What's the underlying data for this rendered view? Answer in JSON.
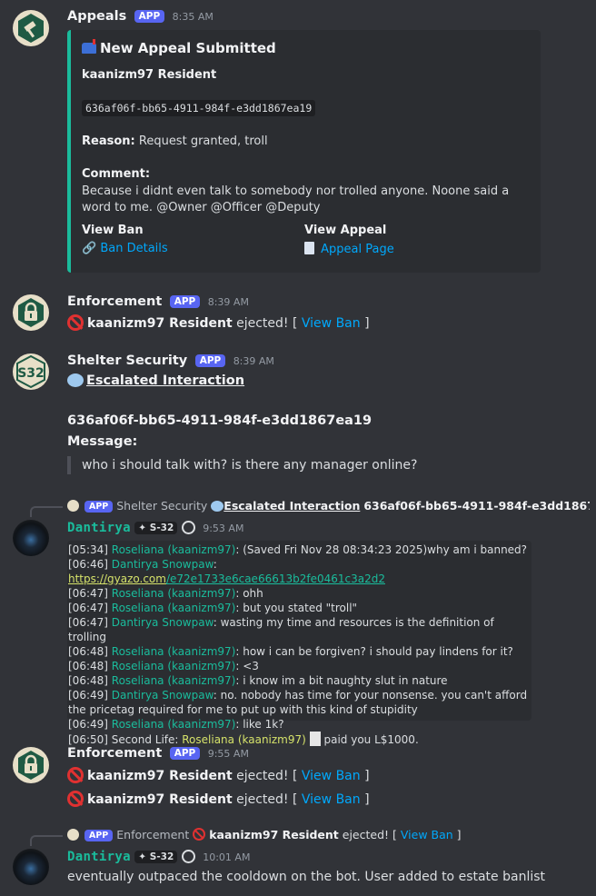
{
  "msg1": {
    "author": "Appeals",
    "tag": "APP",
    "time": "8:35 AM",
    "embed": {
      "title": "New Appeal Submitted",
      "user": "kaanizm97 Resident",
      "id": "636af06f-bb65-4911-984f-e3dd1867ea19",
      "reason_label": "Reason:",
      "reason": "Request granted, troll",
      "comment_label": "Comment:",
      "comment": "Because i didnt even talk to somebody nor trolled anyone. Noone said a word to me. @Owner @Officer @Deputy",
      "field1_title": "View Ban",
      "field1_link": "Ban Details",
      "field2_title": "View Appeal",
      "field2_link": "Appeal Page"
    }
  },
  "msg2": {
    "author": "Enforcement",
    "tag": "APP",
    "time": "8:39 AM",
    "user": "kaanizm97 Resident",
    "text": "ejected! [",
    "link": "View Ban",
    "close": "]"
  },
  "msg3": {
    "author": "Shelter Security",
    "tag": "APP",
    "time": "8:39 AM",
    "avatar_text": "S32",
    "title": "Escalated Interaction",
    "id": "636af06f-bb65-4911-984f-e3dd1867ea19",
    "message_label": "Message:",
    "quote": "who i should talk with? is there any manager online?"
  },
  "msg4": {
    "reply_tag": "APP",
    "reply_author": "Shelter Security",
    "reply_title": "Escalated Interaction",
    "reply_id": "636af06f-bb65-4911-984f-e3dd1867ea...",
    "author": "Dantirya",
    "badge": "S-32",
    "time": "9:53 AM",
    "log": [
      {
        "ts": "[05:34]",
        "who": "Roseliana (kaanizm97)",
        "text": ": (Saved Fri Nov 28 08:34:23 2025)why am i banned?"
      },
      {
        "ts": "[06:46]",
        "who": "Dantirya Snowpaw",
        "text": ": ",
        "url1": "https://gyazo.com",
        "url2": "/e72e1733e6cae66613b2fe0461c3a2d2"
      },
      {
        "ts": "[06:47]",
        "who": "Roseliana (kaanizm97)",
        "text": ": ohh"
      },
      {
        "ts": "[06:47]",
        "who": "Roseliana (kaanizm97)",
        "text": ": but you stated \"troll\""
      },
      {
        "ts": "[06:47]",
        "who": "Dantirya Snowpaw",
        "text": ": wasting my time and resources is the definition of trolling"
      },
      {
        "ts": "[06:48]",
        "who": "Roseliana (kaanizm97)",
        "text": ": how i can be forgiven? i should pay lindens for it?"
      },
      {
        "ts": "[06:48]",
        "who": "Roseliana (kaanizm97)",
        "text": ": <3"
      },
      {
        "ts": "[06:48]",
        "who": "Roseliana (kaanizm97)",
        "text": ": i know im a bit naughty slut in nature"
      },
      {
        "ts": "[06:49]",
        "who": "Dantirya Snowpaw",
        "text": ": no. nobody has time for your nonsense. you can't afford the pricetag required for me to put up with this kind of stupidity"
      },
      {
        "ts": "[06:49]",
        "who": "Roseliana (kaanizm97)",
        "text": ": like 1k?"
      },
      {
        "ts": "[06:50]",
        "who": "Second Life: ",
        "who2": "Roseliana (kaanizm97)",
        "text": " paid you L$1000."
      }
    ]
  },
  "msg5": {
    "author": "Enforcement",
    "tag": "APP",
    "time": "9:55 AM",
    "lines": [
      {
        "user": "kaanizm97 Resident",
        "text": "ejected! [",
        "link": "View Ban",
        "close": "]"
      },
      {
        "user": "kaanizm97 Resident",
        "text": "ejected! [",
        "link": "View Ban",
        "close": "]"
      }
    ]
  },
  "msg6": {
    "reply_tag": "APP",
    "reply_author": "Enforcement",
    "reply_user": "kaanizm97 Resident",
    "reply_text": "ejected! [",
    "reply_link": "View Ban",
    "reply_close": "]",
    "author": "Dantirya",
    "badge": "S-32",
    "time": "10:01 AM",
    "text": "eventually outpaced the cooldown on the bot. User added to estate banlist"
  }
}
